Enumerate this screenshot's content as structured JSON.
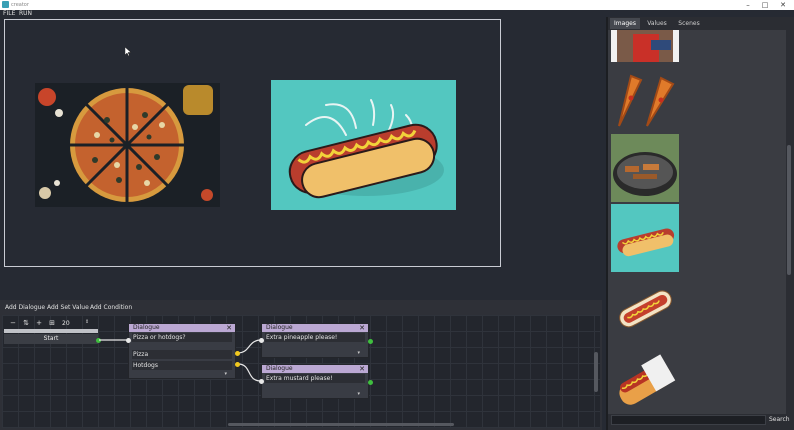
{
  "window": {
    "title": "creator",
    "controls": [
      "–",
      "□",
      "✕"
    ]
  },
  "menu": {
    "file": "FILE",
    "run": "RUN"
  },
  "stage": {
    "images": [
      "pizza-image",
      "hotdog-image"
    ]
  },
  "side_panel": {
    "tabs": [
      "Images",
      "Values",
      "Scenes"
    ],
    "active_tab": "Images",
    "thumbnails": [
      "person-thumb",
      "pizza-slices-thumb",
      "grill-thumb",
      "hotdog-teal-thumb",
      "hotdog-cartoon-thumb",
      "hotdog-bun-thumb"
    ],
    "search_label": "Search"
  },
  "lower_toolbar": {
    "add_dialogue": "Add Dialogue",
    "add_set_value": "Add Set Value",
    "add_condition": "Add Condition"
  },
  "graph": {
    "zoom_value": "20",
    "start_label": "Start",
    "nodes": [
      {
        "header": "Dialogue",
        "text": "Pizza or hotdogs?",
        "options": [
          "Pizza",
          "Hotdogs"
        ]
      },
      {
        "header": "Dialogue",
        "text": "Extra pineapple please!"
      },
      {
        "header": "Dialogue",
        "text": "Extra mustard please!"
      }
    ]
  },
  "colors": {
    "node_header": "#bba8d3",
    "port_green": "#3fbf3f",
    "port_yellow": "#f0c820",
    "teal_bg": "#53c7c0"
  }
}
